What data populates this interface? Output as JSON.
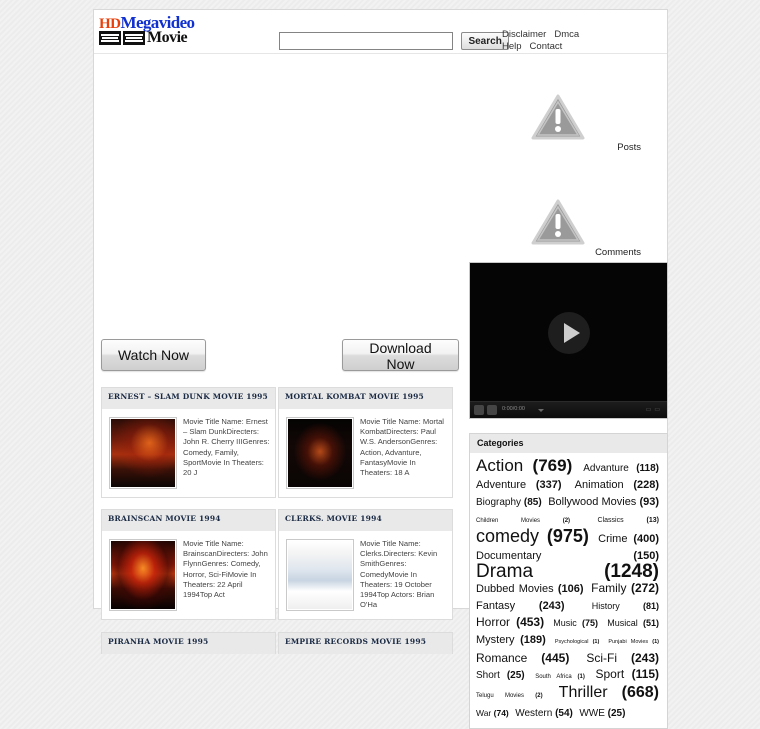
{
  "site": {
    "logo": {
      "hd": "HD",
      "megavideo": "Megavideo",
      "movie": "Movie"
    }
  },
  "search": {
    "value": "",
    "placeholder": "",
    "button_label": "Search"
  },
  "topnav": {
    "items": [
      {
        "label": "Disclaimer"
      },
      {
        "label": "Dmca"
      },
      {
        "label": "Help"
      },
      {
        "label": "Contact"
      }
    ]
  },
  "widgets": {
    "posts_label": "Posts",
    "comments_label": "Comments"
  },
  "actions": {
    "watch_label": "Watch Now",
    "download_label": "Download Now"
  },
  "video": {
    "time_label": "0:00/0:00"
  },
  "movies": [
    {
      "title": "ERNEST – SLAM DUNK MOVIE 1995",
      "description": "Movie Title Name: Ernest – Slam DunkDirecters: John R. Cherry IIIGenres: Comedy, Family, SportMovie In Theaters: 20 J",
      "art": "art-ernest"
    },
    {
      "title": "MORTAL KOMBAT MOVIE 1995",
      "description": "Movie Title Name: Mortal KombatDirecters: Paul W.S. AndersonGenres: Action, Advanture, FantasyMovie In Theaters: 18 A",
      "art": "art-mk"
    },
    {
      "title": "BRAINSCAN MOVIE 1994",
      "description": "Movie Title Name: BrainscanDirecters: John FlynnGenres: Comedy, Horror, Sci-FiMovie In Theaters: 22 April 1994Top Act",
      "art": "art-brainscan"
    },
    {
      "title": "CLERKS. MOVIE 1994",
      "description": "Movie Title Name: Clerks.Directers: Kevin SmithGenres: ComedyMovie In Theaters: 19 October 1994Top Actors: Brian O'Ha",
      "art": "art-clerks"
    }
  ],
  "movies_bottom": [
    {
      "title": "PIRANHA MOVIE 1995"
    },
    {
      "title": "EMPIRE RECORDS MOVIE 1995"
    }
  ],
  "categories": {
    "title": "Categories",
    "items": [
      {
        "label": "Action",
        "count": 769,
        "size": 17
      },
      {
        "label": "Advanture",
        "count": 118,
        "size": 10
      },
      {
        "label": "Adventure",
        "count": 337,
        "size": 11
      },
      {
        "label": "Animation",
        "count": 228,
        "size": 11
      },
      {
        "label": "Biography",
        "count": 85,
        "size": 10
      },
      {
        "label": "Bollywood Movies",
        "count": 93,
        "size": 11
      },
      {
        "label": "Children Movies",
        "count": 2,
        "size": 6
      },
      {
        "label": "Classics",
        "count": 13,
        "size": 7
      },
      {
        "label": "comedy",
        "count": 975,
        "size": 18
      },
      {
        "label": "Crime",
        "count": 400,
        "size": 11
      },
      {
        "label": "Documentary",
        "count": 150,
        "size": 11
      },
      {
        "label": "Drama",
        "count": 1248,
        "size": 19
      },
      {
        "label": "Dubbed Movies",
        "count": 106,
        "size": 11
      },
      {
        "label": "Family",
        "count": 272,
        "size": 12
      },
      {
        "label": "Fantasy",
        "count": 243,
        "size": 11
      },
      {
        "label": "History",
        "count": 81,
        "size": 9
      },
      {
        "label": "Horror",
        "count": 453,
        "size": 12
      },
      {
        "label": "Music",
        "count": 75,
        "size": 9
      },
      {
        "label": "Musical",
        "count": 51,
        "size": 9
      },
      {
        "label": "Mystery",
        "count": 189,
        "size": 11
      },
      {
        "label": "Psychological",
        "count": 1,
        "size": 5.5
      },
      {
        "label": "Punjabi Movies",
        "count": 1,
        "size": 5.5
      },
      {
        "label": "Romance",
        "count": 445,
        "size": 12
      },
      {
        "label": "Sci-Fi",
        "count": 243,
        "size": 12
      },
      {
        "label": "Short",
        "count": 25,
        "size": 10
      },
      {
        "label": "South Africa",
        "count": 1,
        "size": 6
      },
      {
        "label": "Sport",
        "count": 115,
        "size": 12
      },
      {
        "label": "Telugu Movies",
        "count": 2,
        "size": 6
      },
      {
        "label": "Thriller",
        "count": 668,
        "size": 16
      },
      {
        "label": "War",
        "count": 74,
        "size": 8.5
      },
      {
        "label": "Western",
        "count": 54,
        "size": 10
      },
      {
        "label": "WWE",
        "count": 25,
        "size": 10
      }
    ]
  },
  "colors": {
    "logo_hd": "#e8400c",
    "logo_mega": "#1030d0",
    "card_title_text": "#1a2a44",
    "card_header_bg": "#e9e9e9",
    "page_bg": "#eeeeee"
  }
}
